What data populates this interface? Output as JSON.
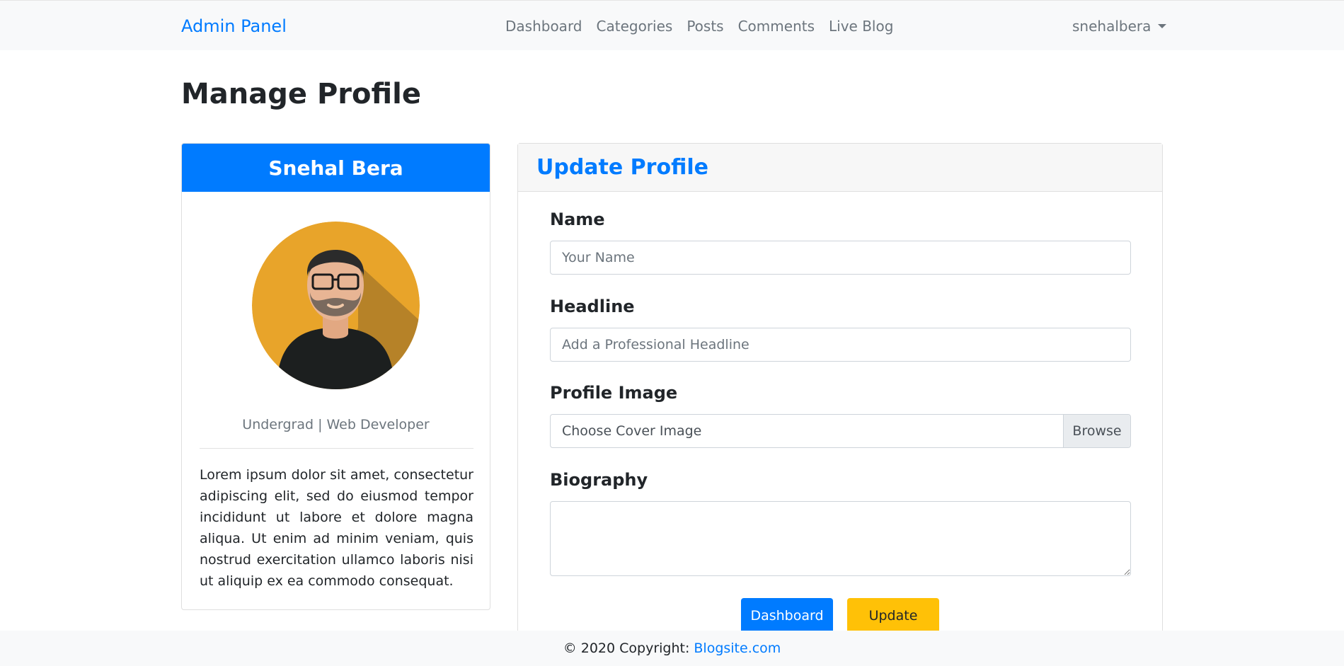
{
  "navbar": {
    "brand": "Admin Panel",
    "links": [
      "Dashboard",
      "Categories",
      "Posts",
      "Comments",
      "Live Blog"
    ],
    "user": "snehalbera"
  },
  "page_title": "Manage Profile",
  "profile_card": {
    "name": "Snehal Bera",
    "headline": "Undergrad | Web Developer",
    "bio": "Lorem ipsum dolor sit amet, consectetur adipiscing elit, sed do eiusmod tempor incididunt ut labore et dolore magna aliqua. Ut enim ad minim veniam, quis nostrud exercitation ullamco laboris nisi ut aliquip ex ea commodo consequat."
  },
  "form": {
    "title": "Update Profile",
    "name_label": "Name",
    "name_placeholder": "Your Name",
    "headline_label": "Headline",
    "headline_placeholder": "Add a Professional Headline",
    "image_label": "Profile Image",
    "image_placeholder": "Choose Cover Image",
    "browse_label": "Browse",
    "bio_label": "Biography",
    "bio_value": "",
    "dashboard_button": "Dashboard",
    "update_button": "Update"
  },
  "footer": {
    "copyright": "© 2020 Copyright:",
    "link": "Blogsite.com"
  },
  "colors": {
    "primary": "#007bff",
    "warning": "#ffc107",
    "navbar_bg": "#f8f9fa",
    "avatar_bg": "#e8a42a"
  }
}
